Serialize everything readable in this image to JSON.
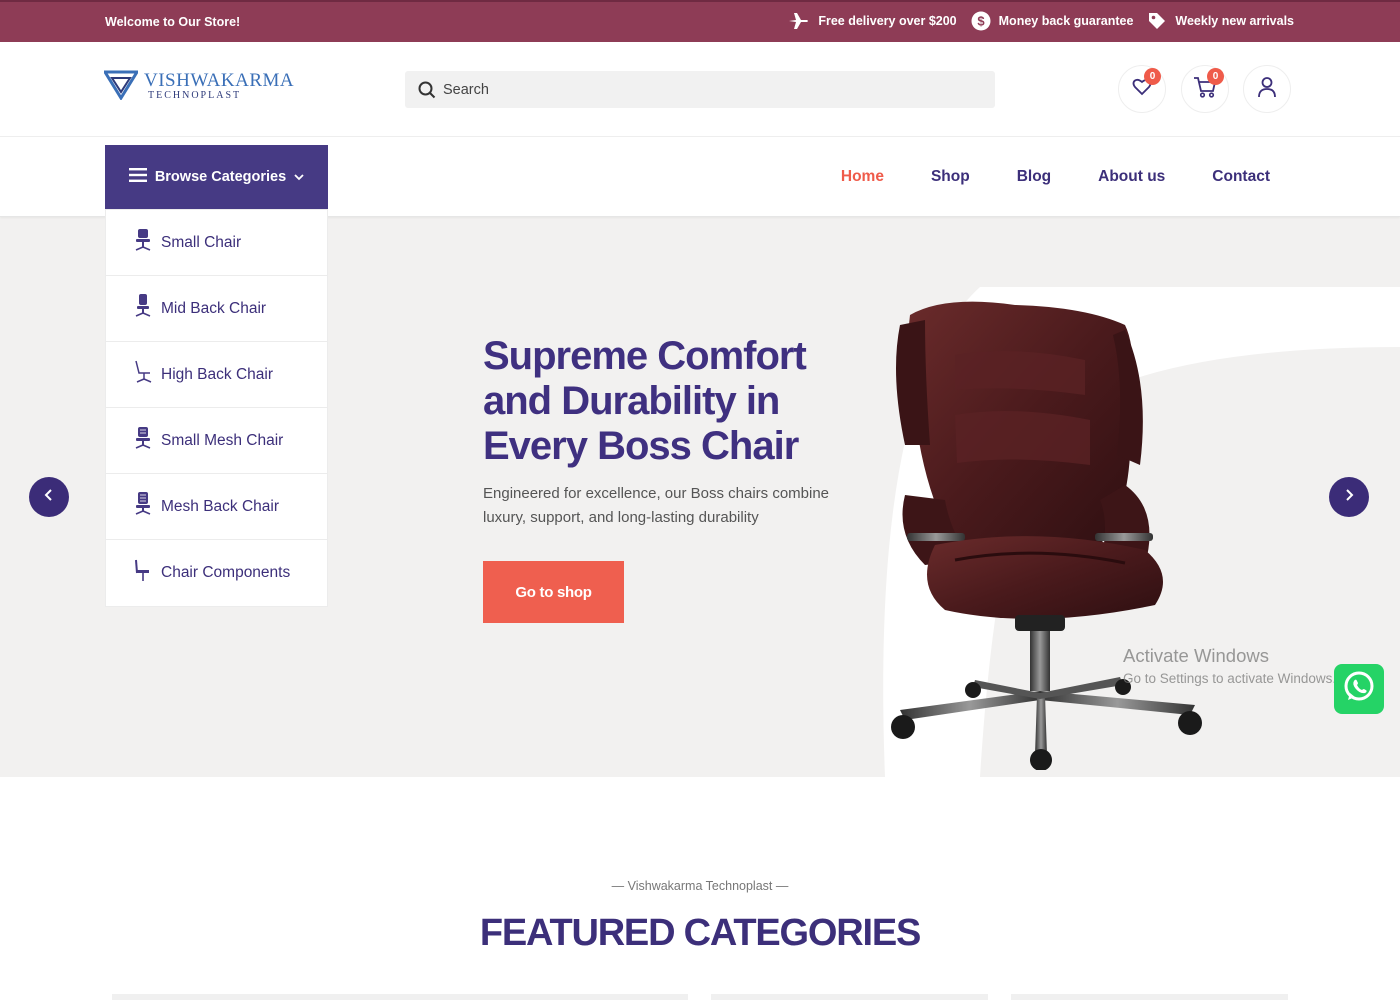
{
  "topbar": {
    "welcome": "Welcome to Our Store!",
    "perks": [
      {
        "icon": "plane-icon",
        "label": "Free delivery over $200"
      },
      {
        "icon": "dollar-icon",
        "label": "Money back guarantee"
      },
      {
        "icon": "tag-icon",
        "label": "Weekly new arrivals"
      }
    ]
  },
  "header": {
    "logo_name": "VISHWAKARMA",
    "logo_sub": "TECHNOPLAST",
    "search_placeholder": "Search",
    "wishlist_count": "0",
    "cart_count": "0"
  },
  "nav": {
    "browse_label": "Browse Categories",
    "links": [
      "Home",
      "Shop",
      "Blog",
      "About us",
      "Contact"
    ],
    "active": "Home"
  },
  "categories": [
    "Small Chair",
    "Mid Back Chair",
    "High Back Chair",
    "Small Mesh Chair",
    "Mesh Back Chair",
    "Chair Components"
  ],
  "hero": {
    "title": "Supreme Comfort and Durability in Every Boss Chair",
    "subtitle": "Engineered for excellence, our Boss chairs combine luxury, support, and long-lasting durability",
    "cta": "Go to shop"
  },
  "watermark": {
    "line1": "Activate Windows",
    "line2": "Go to Settings to activate Windows."
  },
  "featured": {
    "kicker": "— Vishwakarma Technoplast —",
    "title": "FEATURED CATEGORIES"
  },
  "colors": {
    "topbar": "#8e3c56",
    "primary": "#463a84",
    "accent": "#ef5b4a",
    "hero_bg": "#f2f1f0",
    "whatsapp": "#25d366"
  }
}
